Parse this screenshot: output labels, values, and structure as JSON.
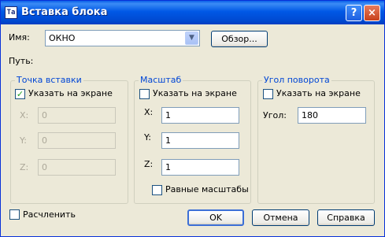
{
  "window": {
    "title": "Вставка блока",
    "app_icon_text": "Ta"
  },
  "titlebar": {
    "help_glyph": "?",
    "close_glyph": "×"
  },
  "name": {
    "label": "Имя:",
    "value": "ОКНО",
    "browse": "Обзор..."
  },
  "path": {
    "label": "Путь:"
  },
  "insertion": {
    "title": "Точка вставки",
    "specify": "Указать на экране",
    "specify_checked": true,
    "x_label": "X:",
    "x_value": "0",
    "y_label": "Y:",
    "y_value": "0",
    "z_label": "Z:",
    "z_value": "0"
  },
  "scale": {
    "title": "Масштаб",
    "specify": "Указать на экране",
    "specify_checked": false,
    "x_label": "X:",
    "x_value": "1",
    "y_label": "Y:",
    "y_value": "1",
    "z_label": "Z:",
    "z_value": "1",
    "uniform": "Равные масштабы",
    "uniform_checked": false
  },
  "rotation": {
    "title": "Угол поворота",
    "specify": "Указать на экране",
    "specify_checked": false,
    "angle_label": "Угол:",
    "angle_value": "180"
  },
  "explode": {
    "label": "Расчленить",
    "checked": false
  },
  "buttons": {
    "ok": "OK",
    "cancel": "Отмена",
    "help": "Справка"
  },
  "colors": {
    "title_bar": "#0058e6",
    "group_title": "#0046d5",
    "face": "#ece9d8"
  }
}
